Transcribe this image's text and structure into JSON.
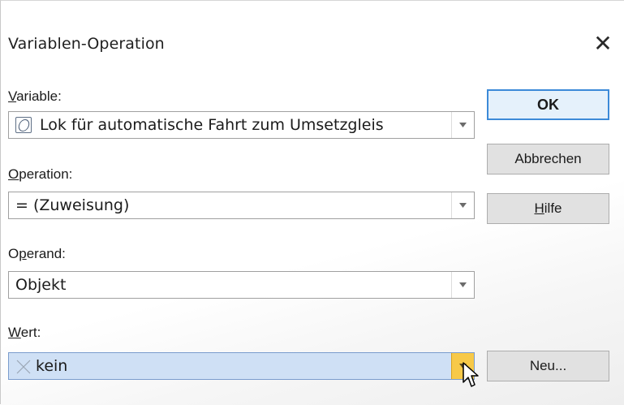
{
  "window": {
    "title": "Variablen-Operation",
    "close_label": "✕"
  },
  "form": {
    "variable_label_u": "V",
    "variable_label_rest": "ariable:",
    "variable_value": "Lok für automatische Fahrt zum Umsetzgleis",
    "operation_label_u": "O",
    "operation_label_rest": "peration:",
    "operation_value": "= (Zuweisung)",
    "operand_label_pre": "O",
    "operand_label_u": "p",
    "operand_label_rest": "erand:",
    "operand_value": "Objekt",
    "wert_label_u": "W",
    "wert_label_rest": "ert:",
    "wert_value": "kein"
  },
  "buttons": {
    "ok": "OK",
    "cancel": "Abbrechen",
    "help_u": "H",
    "help_rest": "ilfe",
    "new": "Neu..."
  },
  "icons": {
    "variable_icon": "object-icon",
    "wert_icon": "none-x-icon",
    "dropdown": "chevron-down-icon",
    "cursor": "mouse-pointer-icon"
  },
  "colors": {
    "selected_field": "#cfe0f5",
    "hover_arrow": "#f7c948",
    "default_button_border": "#3c8ad8"
  }
}
